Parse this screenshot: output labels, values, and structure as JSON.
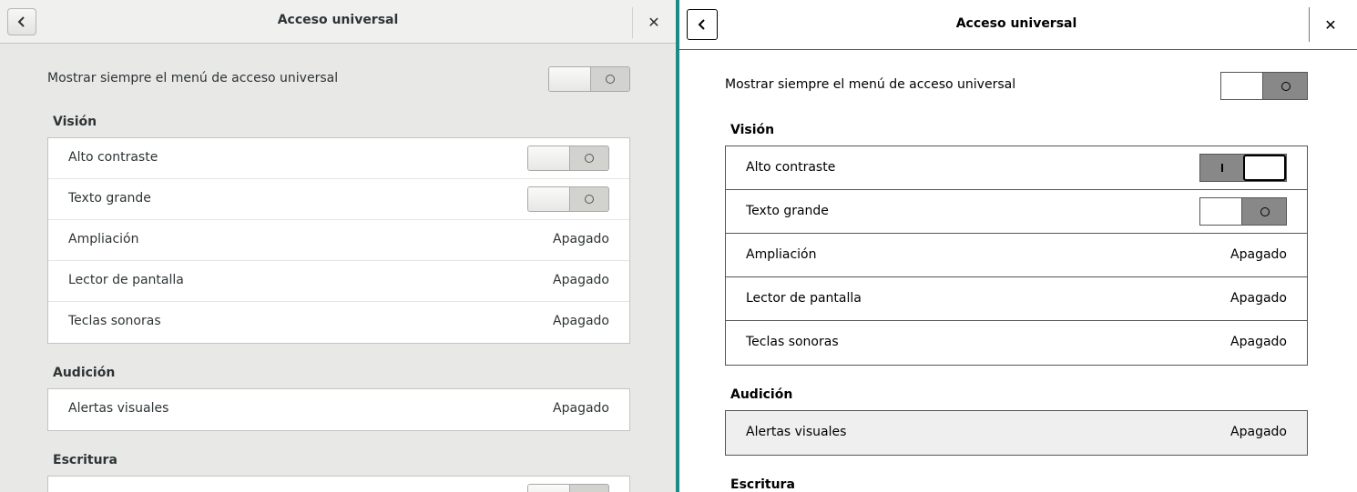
{
  "left_window": {
    "title": "Acceso universal",
    "close_label": "✕",
    "always_show_label": "Mostrar siempre el menú de acceso universal",
    "vision": {
      "heading": "Visión",
      "rows": [
        {
          "label": "Alto contraste",
          "control": "switch",
          "state": "off"
        },
        {
          "label": "Texto grande",
          "control": "switch",
          "state": "off"
        },
        {
          "label": "Ampliación",
          "value": "Apagado"
        },
        {
          "label": "Lector de pantalla",
          "value": "Apagado"
        },
        {
          "label": "Teclas sonoras",
          "value": "Apagado"
        }
      ]
    },
    "hearing": {
      "heading": "Audición",
      "rows": [
        {
          "label": "Alertas visuales",
          "value": "Apagado"
        }
      ]
    },
    "typing": {
      "heading": "Escritura"
    }
  },
  "right_window": {
    "title": "Acceso universal",
    "close_label": "✕",
    "always_show_label": "Mostrar siempre el menú de acceso universal",
    "vision": {
      "heading": "Visión",
      "rows": [
        {
          "label": "Alto contraste",
          "control": "switch",
          "state": "on"
        },
        {
          "label": "Texto grande",
          "control": "switch",
          "state": "off"
        },
        {
          "label": "Ampliación",
          "value": "Apagado"
        },
        {
          "label": "Lector de pantalla",
          "value": "Apagado"
        },
        {
          "label": "Teclas sonoras",
          "value": "Apagado"
        }
      ]
    },
    "hearing": {
      "heading": "Audición",
      "rows": [
        {
          "label": "Alertas visuales",
          "value": "Apagado",
          "highlighted": true
        }
      ]
    },
    "typing": {
      "heading": "Escritura"
    }
  },
  "colors": {
    "desktop": "#1c8a87",
    "left_bg": "#e8e8e7",
    "right_bg": "#ffffff",
    "switch_track_hc": "#888888"
  },
  "icons": {
    "back": "chevron-left-icon",
    "close": "close-icon"
  }
}
